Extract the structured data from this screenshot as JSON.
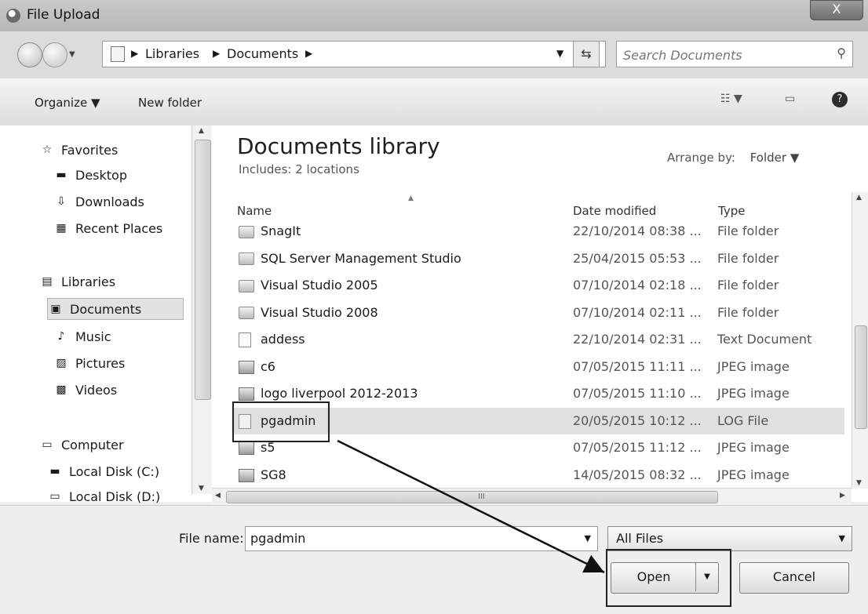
{
  "window": {
    "title": "File Upload",
    "close_glyph": "X"
  },
  "address": {
    "crumbs": [
      "Libraries",
      "Documents"
    ]
  },
  "search": {
    "placeholder": "Search Documents"
  },
  "toolbar": {
    "organize": "Organize ▼",
    "new_folder": "New folder"
  },
  "navpane": {
    "favorites": "Favorites",
    "desktop": "Desktop",
    "downloads": "Downloads",
    "recent": "Recent Places",
    "libraries": "Libraries",
    "documents": "Documents",
    "music": "Music",
    "pictures": "Pictures",
    "videos": "Videos",
    "computer": "Computer",
    "disk_c": "Local Disk (C:)",
    "disk_d": "Local Disk (D:)"
  },
  "library": {
    "title": "Documents library",
    "includes": "Includes:  2 locations",
    "arrange_label": "Arrange by:",
    "arrange_value": "Folder ▼"
  },
  "columns": {
    "name": "Name",
    "date": "Date modified",
    "type": "Type"
  },
  "files": [
    {
      "name": "SnagIt",
      "date": "22/10/2014 08:38 ...",
      "type": "File folder",
      "kind": "folder"
    },
    {
      "name": "SQL Server Management Studio",
      "date": "25/04/2015 05:53 ...",
      "type": "File folder",
      "kind": "folder"
    },
    {
      "name": "Visual Studio 2005",
      "date": "07/10/2014 02:18 ...",
      "type": "File folder",
      "kind": "folder"
    },
    {
      "name": "Visual Studio 2008",
      "date": "07/10/2014 02:11 ...",
      "type": "File folder",
      "kind": "folder"
    },
    {
      "name": "addess",
      "date": "22/10/2014 02:31 ...",
      "type": "Text Document",
      "kind": "text"
    },
    {
      "name": "c6",
      "date": "07/05/2015 11:11 ...",
      "type": "JPEG image",
      "kind": "image"
    },
    {
      "name": "logo liverpool 2012-2013",
      "date": "07/05/2015 11:10 ...",
      "type": "JPEG image",
      "kind": "image"
    },
    {
      "name": "pgadmin",
      "date": "20/05/2015 10:12 ...",
      "type": "LOG File",
      "kind": "log",
      "selected": true
    },
    {
      "name": "s5",
      "date": "07/05/2015 11:12 ...",
      "type": "JPEG image",
      "kind": "image"
    },
    {
      "name": "SG8",
      "date": "14/05/2015 08:32 ...",
      "type": "JPEG image",
      "kind": "image"
    }
  ],
  "bottom": {
    "filename_label": "File name:",
    "filename_value": "pgadmin",
    "filetype": "All Files",
    "open": "Open",
    "cancel": "Cancel"
  },
  "scroll": {
    "h_grip": "III",
    "v_grip": "≡"
  }
}
